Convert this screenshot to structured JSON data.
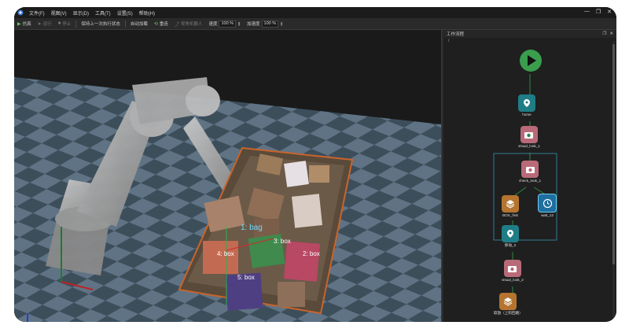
{
  "menu": {
    "items": [
      "文件(F)",
      "视图(V)",
      "显示(D)",
      "工具(T)",
      "设置(S)",
      "帮助(H)"
    ]
  },
  "toolbar": {
    "simulate": "仿真",
    "run": "运行",
    "stop": "停止",
    "keep_last_state": "保持上一次执行状态",
    "auto_load": "自动加载",
    "redraw": "重连",
    "view_angle": "视角机器人",
    "speed_label": "速度",
    "speed_value": "100 %",
    "accel_label": "加速度",
    "accel_value": "100 %"
  },
  "panel": {
    "title": "工作流程",
    "path": "/",
    "nodes": {
      "home": "home",
      "visual_look_1": "visual_look_1",
      "check_look": "check_look_1",
      "box_first": "BOX_first",
      "wait": "wait_12",
      "point2": "移动_2",
      "visual_look_2": "visual_look_2",
      "box_upper": "取放（上料回路）"
    }
  },
  "scene": {
    "labels": [
      "1: bag",
      "3: box",
      "4: box",
      "2: box",
      "5: box"
    ]
  },
  "colors": {
    "start": "#3a9e4d",
    "teal": "#1f7d86",
    "pink": "#b86a78",
    "orange": "#b5742f",
    "blue": "#1e6ea0",
    "magenta": "#c64bc4",
    "floor_dark": "#3d4e5b",
    "floor_light": "#5f7385"
  }
}
